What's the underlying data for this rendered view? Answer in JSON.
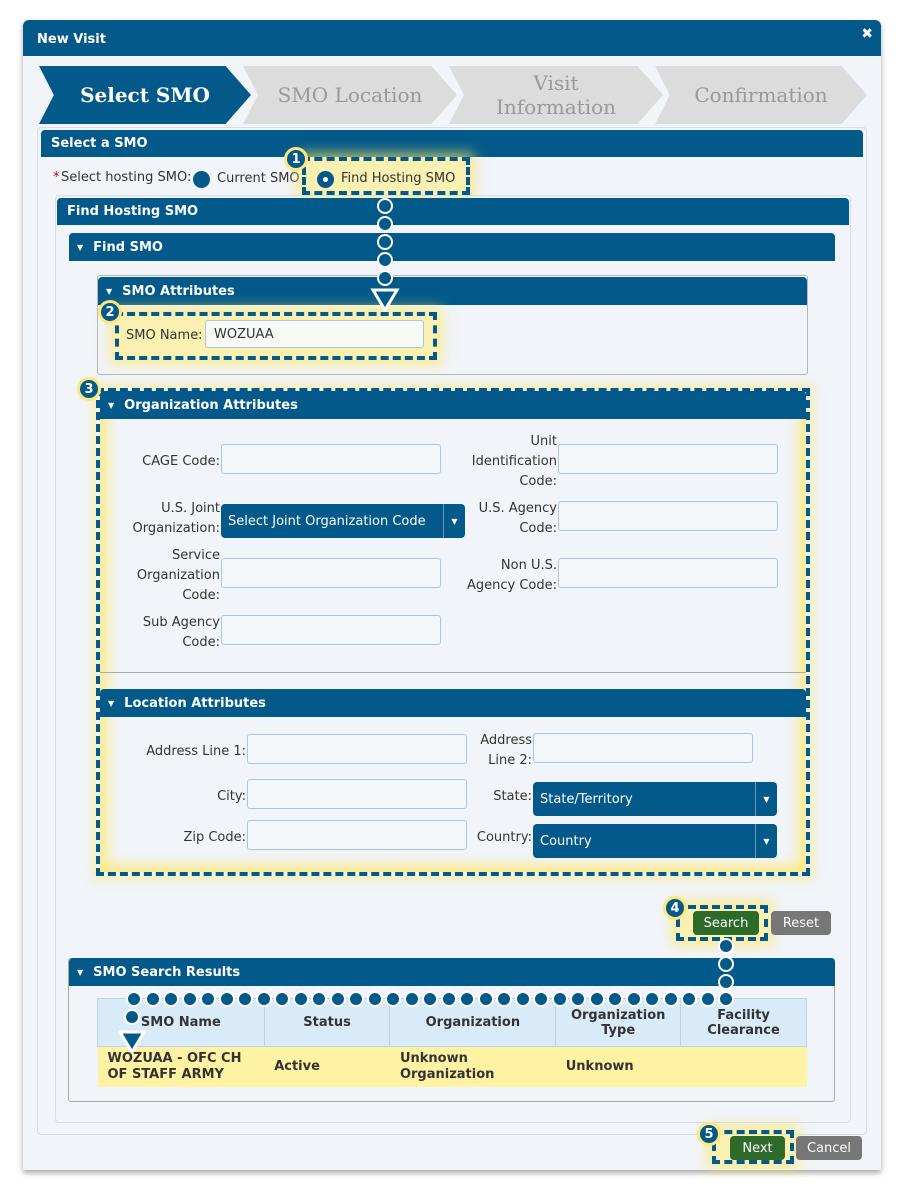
{
  "dialog": {
    "title": "New Visit",
    "close_icon": "close-icon"
  },
  "wizard": {
    "steps": [
      {
        "label": "Select SMO",
        "active": true
      },
      {
        "label": "SMO Location",
        "active": false
      },
      {
        "label": "Visit Information",
        "active": false
      },
      {
        "label": "Confirmation",
        "active": false
      }
    ]
  },
  "select_smo": {
    "header": "Select a SMO",
    "required_marker": "*",
    "hosting_label": "Select hosting SMO:",
    "options": [
      {
        "label": "Current SMO",
        "selected": false
      },
      {
        "label": "Find Hosting SMO",
        "selected": true
      }
    ]
  },
  "find_hosting": {
    "header": "Find Hosting SMO",
    "find_smo_header": "Find SMO",
    "smo_attributes": {
      "header": "SMO Attributes",
      "smo_name_label": "SMO Name:",
      "smo_name_value": "WOZUAA"
    },
    "org_attributes": {
      "header": "Organization Attributes",
      "cage_label": "CAGE Code:",
      "uic_label": "Unit Identification Code:",
      "joint_org_label": "U.S. Joint Organization:",
      "joint_org_select": "Select Joint Organization Code",
      "us_agency_label": "U.S. Agency Code:",
      "service_org_label": "Service Organization Code:",
      "non_us_agency_label": "Non U.S. Agency Code:",
      "sub_agency_label": "Sub Agency Code:"
    },
    "location_attributes": {
      "header": "Location Attributes",
      "address1_label": "Address Line 1:",
      "address2_label": "Address Line 2:",
      "city_label": "City:",
      "state_label": "State:",
      "state_select": "State/Territory",
      "zip_label": "Zip Code:",
      "country_label": "Country:",
      "country_select": "Country"
    },
    "search_button": "Search",
    "reset_button": "Reset"
  },
  "results": {
    "header": "SMO Search Results",
    "columns": [
      "SMO Name",
      "Status",
      "Organization",
      "Organization Type",
      "Facility Clearance"
    ],
    "rows": [
      [
        "WOZUAA - OFC CH OF STAFF ARMY",
        "Active",
        "Unknown Organization",
        "Unknown",
        ""
      ]
    ]
  },
  "footer": {
    "next_button": "Next",
    "cancel_button": "Cancel"
  },
  "callouts": [
    "1",
    "2",
    "3",
    "4",
    "5"
  ],
  "colors": {
    "primary": "#035a8a",
    "highlight": "#ffe680",
    "go_button": "#2e6b2a",
    "neutral_button": "#777777",
    "row_highlight": "#fff3a3"
  }
}
